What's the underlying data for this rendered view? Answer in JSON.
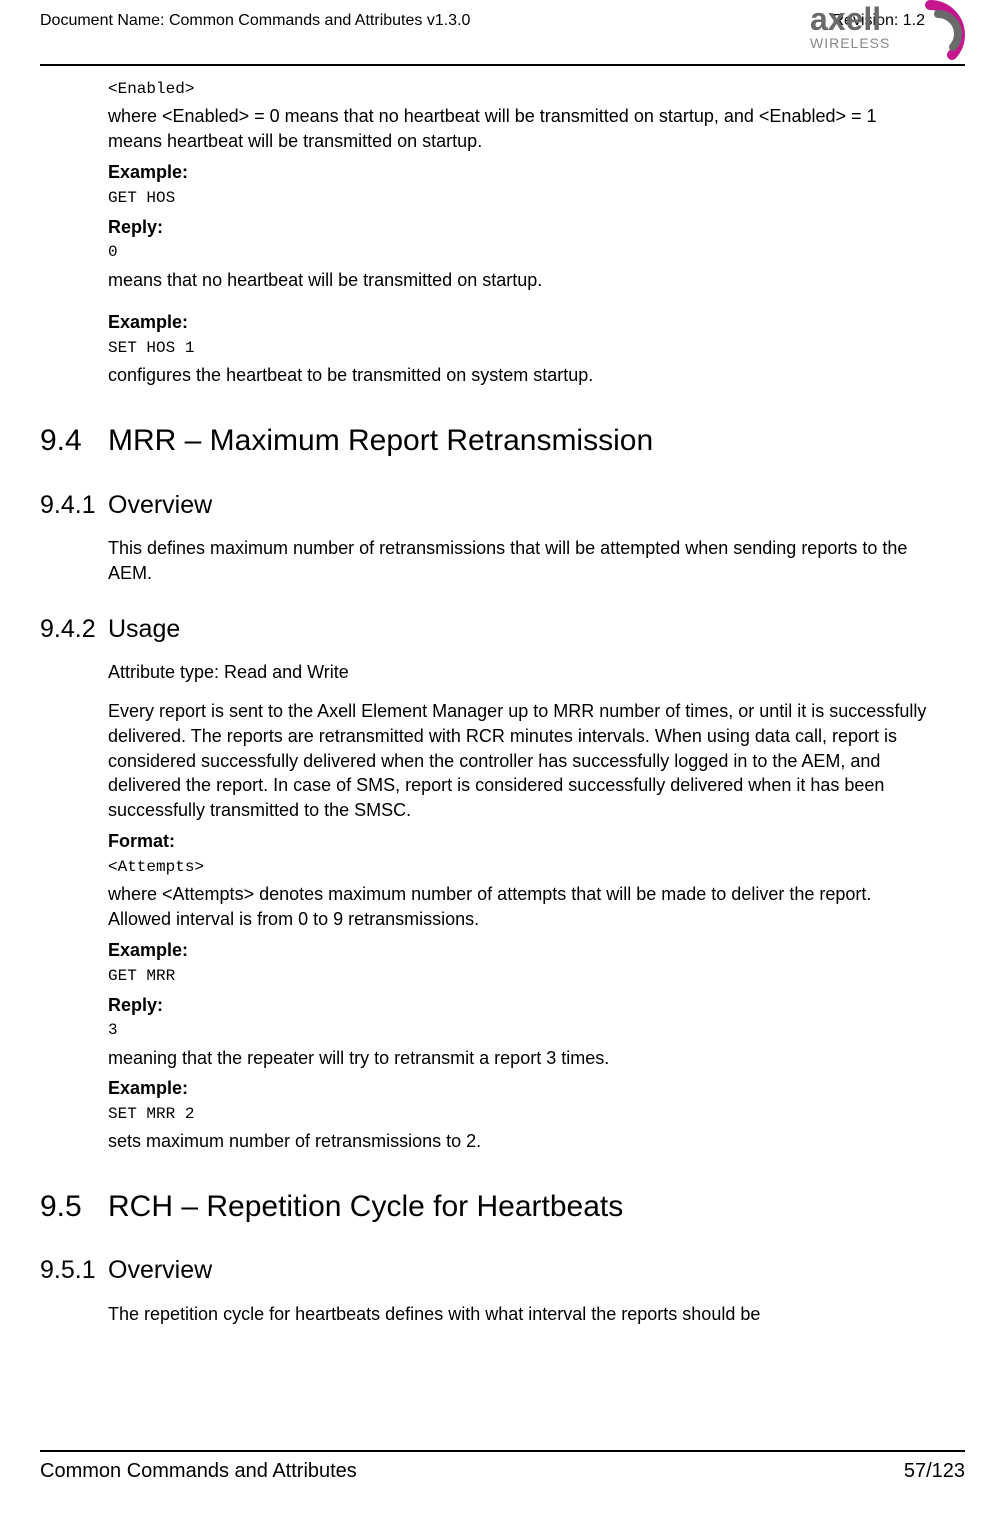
{
  "header": {
    "doc_name_label": "Document Name: Common Commands and Attributes v1.3.0",
    "revision_label": "Revision: 1.2",
    "logo_text_main": "axell",
    "logo_text_sub": "WIRELESS"
  },
  "body": {
    "enabled_tag": "<Enabled>",
    "enabled_desc": "where <Enabled> = 0 means that no heartbeat will be transmitted on startup, and <Enabled> = 1 means heartbeat will be transmitted on startup.",
    "example_label": "Example:",
    "get_hos": "GET HOS",
    "reply_label": "Reply:",
    "reply_0": "0",
    "reply_0_desc": "means that no heartbeat will be transmitted on startup.",
    "set_hos": "SET HOS 1",
    "set_hos_desc": "configures the heartbeat to be transmitted on system startup.",
    "h94_num": "9.4",
    "h94_title": "MRR – Maximum Report Retransmission",
    "h941_num": "9.4.1",
    "h941_title": "Overview",
    "h941_body": "This defines maximum number of retransmissions that will be attempted when sending reports to the AEM.",
    "h942_num": "9.4.2",
    "h942_title": "Usage",
    "attr_type": "Attribute type: Read and Write",
    "usage_body": "Every report is sent to the Axell Element Manager up to MRR number of times, or until it is successfully delivered. The reports are retransmitted with RCR minutes intervals. When using data call, report is considered successfully delivered when the controller has successfully logged in to the AEM, and delivered the report. In case of SMS, report is considered successfully delivered when it has been successfully transmitted to the SMSC.",
    "format_label": "Format:",
    "attempts_tag": "<Attempts>",
    "attempts_desc": "where <Attempts> denotes maximum number of attempts that will be made to deliver the report. Allowed interval is from 0 to 9 retransmissions.",
    "get_mrr": "GET MRR",
    "reply_3": "3",
    "reply_3_desc": "meaning that the repeater will try to retransmit a report 3 times.",
    "set_mrr": "SET MRR 2",
    "set_mrr_desc": "sets maximum number of retransmissions to 2.",
    "h95_num": "9.5",
    "h95_title": "RCH – Repetition Cycle for Heartbeats",
    "h951_num": "9.5.1",
    "h951_title": "Overview",
    "h951_body": "The repetition cycle for heartbeats defines with what interval the reports should be"
  },
  "footer": {
    "left": "Common Commands and Attributes",
    "right": "57/123"
  }
}
